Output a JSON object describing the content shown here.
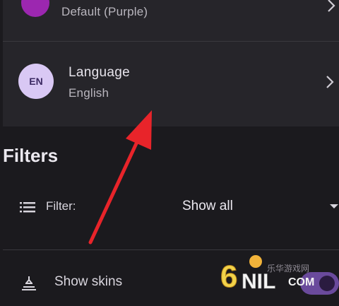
{
  "theme": {
    "value": "Default (Purple)",
    "color": "#9c27b0"
  },
  "language": {
    "title": "Language",
    "value": "English",
    "badge": "EN"
  },
  "filters": {
    "title": "Filters",
    "filter_label": "Filter:",
    "filter_value": "Show all",
    "skins_label": "Show skins"
  },
  "watermark": {
    "chinese": "乐华游戏网",
    "number": "6",
    "domain_part": "NIL",
    "tld": "COM"
  },
  "annotation": {
    "arrow_color": "#e8242a"
  },
  "colors": {
    "accent": "#6a4a9c",
    "avatar_bg": "#d9c8f4"
  }
}
